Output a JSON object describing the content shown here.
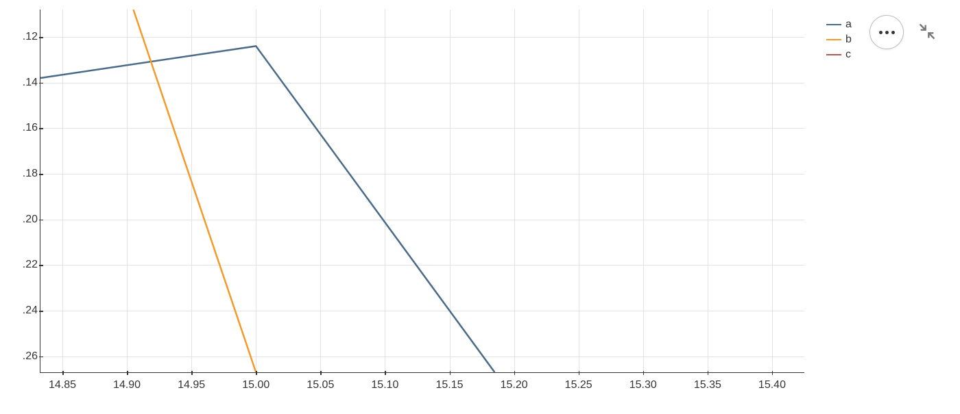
{
  "chart_data": {
    "type": "line",
    "x_ticks": [
      14.85,
      14.9,
      14.95,
      15.0,
      15.05,
      15.1,
      15.15,
      15.2,
      15.25,
      15.3,
      15.35,
      15.4
    ],
    "y_ticks": [
      0.12,
      0.14,
      0.16,
      0.18,
      0.2,
      0.22,
      0.24,
      0.26
    ],
    "xlim": [
      14.833,
      15.425
    ],
    "ylim": [
      0.267,
      0.108
    ],
    "series": [
      {
        "name": "a",
        "color": "#4a6a8a",
        "points": [
          [
            14.833,
            0.138
          ],
          [
            15.0,
            0.124
          ],
          [
            15.185,
            0.267
          ]
        ]
      },
      {
        "name": "b",
        "color": "#f39a2b",
        "points": [
          [
            14.905,
            0.108
          ],
          [
            15.0,
            0.267
          ]
        ]
      },
      {
        "name": "c",
        "color": "#b55454",
        "points": []
      }
    ],
    "y_tick_labels": [
      ".12",
      ".14",
      ".16",
      ".18",
      ".20",
      ".22",
      ".24",
      ".26"
    ],
    "x_tick_labels": [
      "14.85",
      "14.90",
      "14.95",
      "15.00",
      "15.05",
      "15.10",
      "15.15",
      "15.20",
      "15.25",
      "15.30",
      "15.35",
      "15.40"
    ]
  },
  "legend": {
    "items": [
      "a",
      "b",
      "c"
    ]
  },
  "colors": {
    "a": "#4a6a8a",
    "b": "#f39a2b",
    "c": "#b55454"
  }
}
